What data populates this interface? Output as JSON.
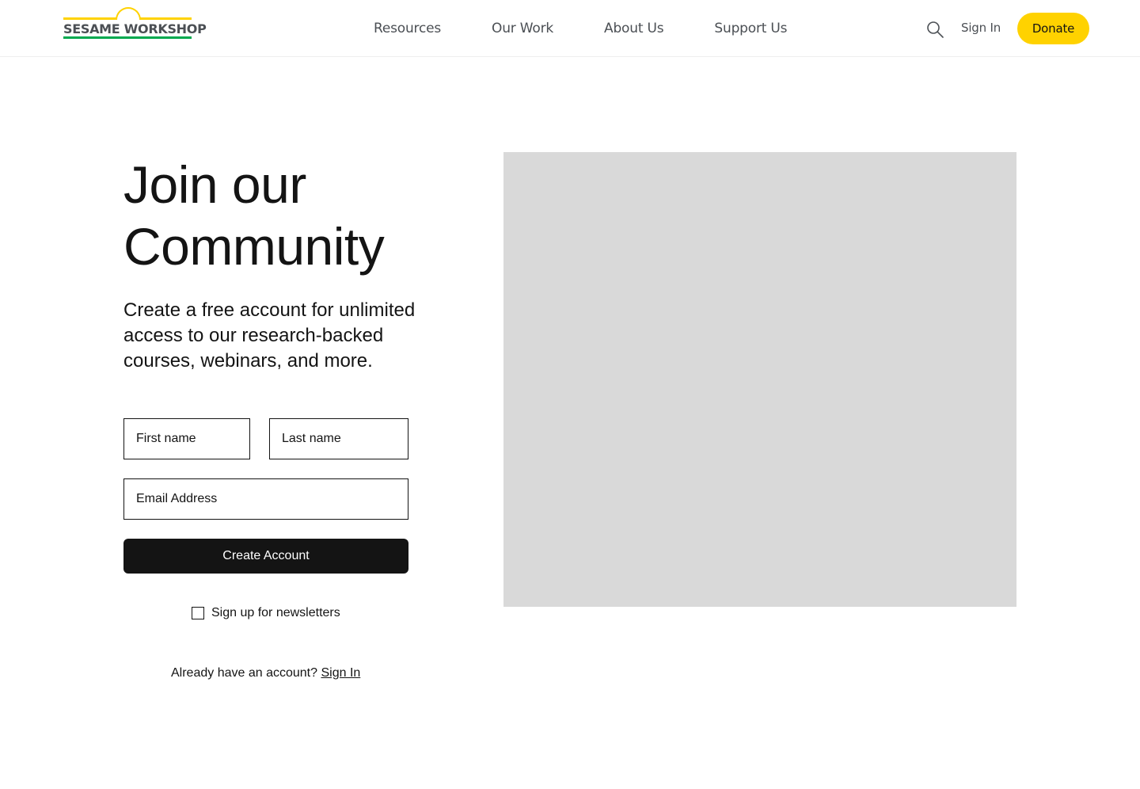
{
  "header": {
    "logo_text": "SESAME WORKSHOP",
    "nav": [
      "Resources",
      "Our Work",
      "About Us",
      "Support Us"
    ],
    "search_icon": "search-icon",
    "signin_label": "Sign In",
    "donate_label": "Donate"
  },
  "colors": {
    "brand_yellow": "#ffd200",
    "brand_green": "#00a94f",
    "text_dark": "#141414",
    "nav_gray": "#4b4f54",
    "placeholder_gray": "#d9d9d9"
  },
  "main": {
    "title_line1": "Join our",
    "title_line2": "Community",
    "description": "Create a free account for unlimited access to our research-backed courses, webinars, and more.",
    "form": {
      "first_name_placeholder": "First name",
      "last_name_placeholder": "Last name",
      "email_placeholder": "Email Address",
      "submit_label": "Create Account",
      "newsletter_label": "Sign up for newsletters",
      "already_text": "Already have an account?",
      "signin_link": "Sign In"
    }
  }
}
